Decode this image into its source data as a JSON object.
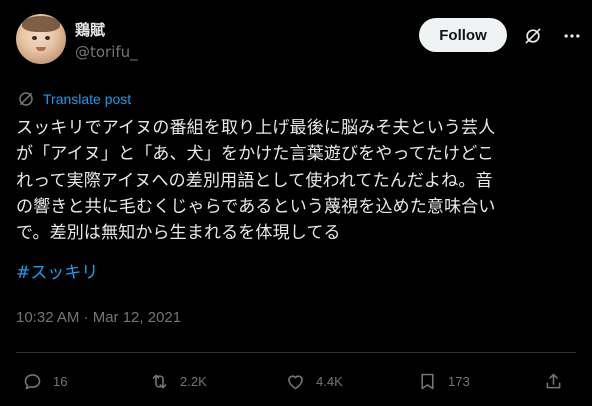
{
  "author": {
    "display_name": "鶏賦",
    "handle": "@torifu_"
  },
  "header": {
    "follow_label": "Follow"
  },
  "translate": {
    "label": "Translate post"
  },
  "tweet": {
    "text": "スッキリでアイヌの番組を取り上げ最後に脳みそ夫という芸人\nが「アイヌ」と「あ、犬」をかけた言葉遊びをやってたけどこ\nれって実際アイヌへの差別用語として使われてたんだよね。音\nの響きと共に毛むくじゃらであるという蔑視を込めた意味合い\nで。差別は無知から生まれるを体現してる",
    "hashtag": "#スッキリ",
    "timestamp": "10:32 AM · Mar 12, 2021"
  },
  "actions": {
    "replies": "16",
    "reposts": "2.2K",
    "likes": "4.4K",
    "bookmarks": "173"
  },
  "colors": {
    "background": "#000000",
    "text": "#e7e9ea",
    "muted": "#71767b",
    "link": "#1d9bf0",
    "follow_bg": "#eff3f4"
  },
  "icons": [
    "grok-icon",
    "more-icon",
    "translate-icon",
    "reply-icon",
    "repost-icon",
    "like-icon",
    "bookmark-icon",
    "share-icon"
  ]
}
